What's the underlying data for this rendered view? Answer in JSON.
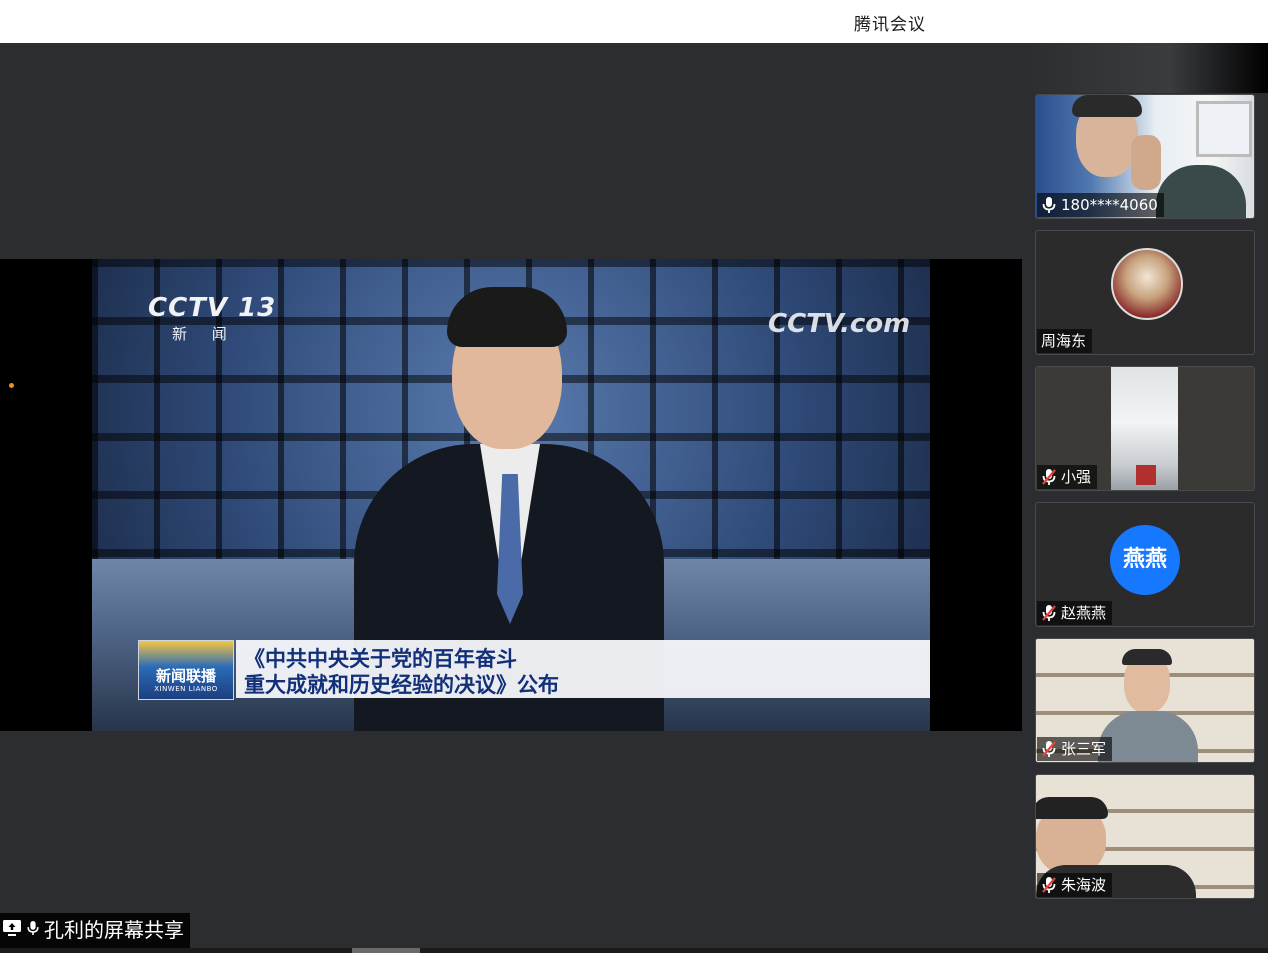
{
  "app": {
    "title": "腾讯会议"
  },
  "share": {
    "presenter_label": "孔利的屏幕共享",
    "broadcast": {
      "channel_logo": "CCTV 13",
      "channel_sub": "新 闻",
      "watermark": "CCTV.com",
      "program_name": "新闻联播",
      "program_pinyin": "XINWEN LIANBO",
      "headline_line1": "《中共中央关于党的百年奋斗",
      "headline_line2": "重大成就和历史经验的决议》公布"
    }
  },
  "participants": [
    {
      "name": "180****4060",
      "mic": "on",
      "view": "camera"
    },
    {
      "name": "周海东",
      "mic": "none",
      "view": "avatar-photo"
    },
    {
      "name": "小强",
      "mic": "muted",
      "view": "camera"
    },
    {
      "name": "赵燕燕",
      "mic": "muted",
      "view": "avatar-text",
      "avatar_text": "燕燕",
      "avatar_color": "#1677ff"
    },
    {
      "name": "张三军",
      "mic": "muted",
      "view": "camera"
    },
    {
      "name": "朱海波",
      "mic": "muted",
      "view": "camera"
    }
  ],
  "colors": {
    "accent": "#1677ff",
    "muted_icon": "#e5443a",
    "panel_bg": "#2b2d30"
  }
}
